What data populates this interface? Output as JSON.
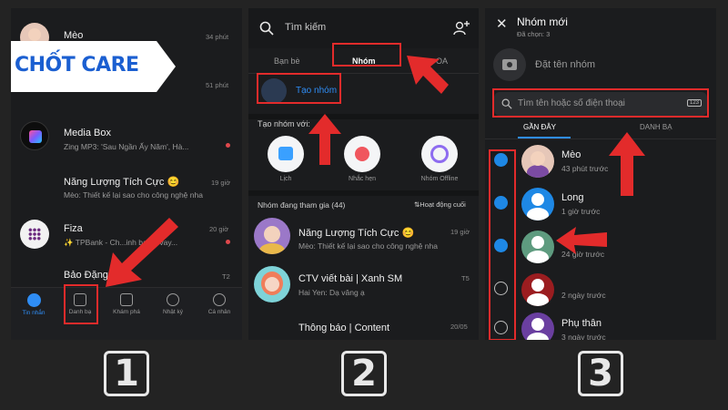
{
  "colors": {
    "accent": "#1e88e5",
    "highlight": "#e32b2b",
    "background": "#1b1c1e"
  },
  "logo": {
    "text": "CHỐT CARE"
  },
  "panel1": {
    "chats": [
      {
        "name": "Mèo",
        "time": "34 phút"
      },
      {
        "name": "",
        "time": "51 phút"
      },
      {
        "name": "Media Box",
        "preview": "Zing MP3: 'Sau Ngần Ấy Năm', Hà..."
      },
      {
        "name": "Năng Lượng Tích Cực 😊",
        "preview": "Mèo: Thiết kế lại sao cho công nghệ nha",
        "time": "19 giờ"
      },
      {
        "name": "Fiza",
        "preview": "✨ TPBank - Ch...inh bạch, vay...",
        "time": "20 giờ"
      },
      {
        "name": "Bảo Đặng",
        "preview": "...",
        "time": "T2"
      }
    ],
    "nav": [
      "Tin nhắn",
      "Danh bạ",
      "Khám phá",
      "Nhật ký",
      "Cá nhân"
    ]
  },
  "panel2": {
    "search_placeholder": "Tìm kiếm",
    "tabs": [
      "Bạn bè",
      "Nhóm",
      "OA"
    ],
    "create_group": "Tạo nhóm",
    "create_with": "Tạo nhóm với:",
    "quick": [
      "Lịch",
      "Nhắc hẹn",
      "Nhóm Offline"
    ],
    "groups_header": "Nhóm đang tham gia (44)",
    "sort_label": "⇅Hoạt động cuối",
    "groups": [
      {
        "name": "Năng Lượng Tích Cực 😊",
        "preview": "Mèo: Thiết kế lại sao cho công nghệ nha",
        "time": "19 giờ"
      },
      {
        "name": "CTV viết bài | Xanh SM",
        "preview": "Hai Yen: Dạ vâng ạ",
        "time": "T5"
      },
      {
        "name": "Thông báo | Content",
        "preview": "...",
        "time": "20/05"
      }
    ]
  },
  "panel3": {
    "title": "Nhóm mới",
    "selected": "Đã chọn: 3",
    "name_placeholder": "Đặt tên nhóm",
    "search_placeholder": "Tìm tên hoặc số điện thoại",
    "keyboard_badge": "123",
    "tabs": [
      "GẦN ĐÂY",
      "DANH BẠ"
    ],
    "contacts": [
      {
        "name": "Mèo",
        "status": "43 phút trước",
        "checked": true
      },
      {
        "name": "Long",
        "status": "1 giờ trước",
        "checked": true
      },
      {
        "name": "",
        "status": "24 giờ trước",
        "checked": true
      },
      {
        "name": "",
        "status": "2 ngày trước",
        "checked": false
      },
      {
        "name": "Phụ thân",
        "status": "3 ngày trước",
        "checked": false
      }
    ]
  },
  "steps": [
    "1",
    "2",
    "3"
  ]
}
